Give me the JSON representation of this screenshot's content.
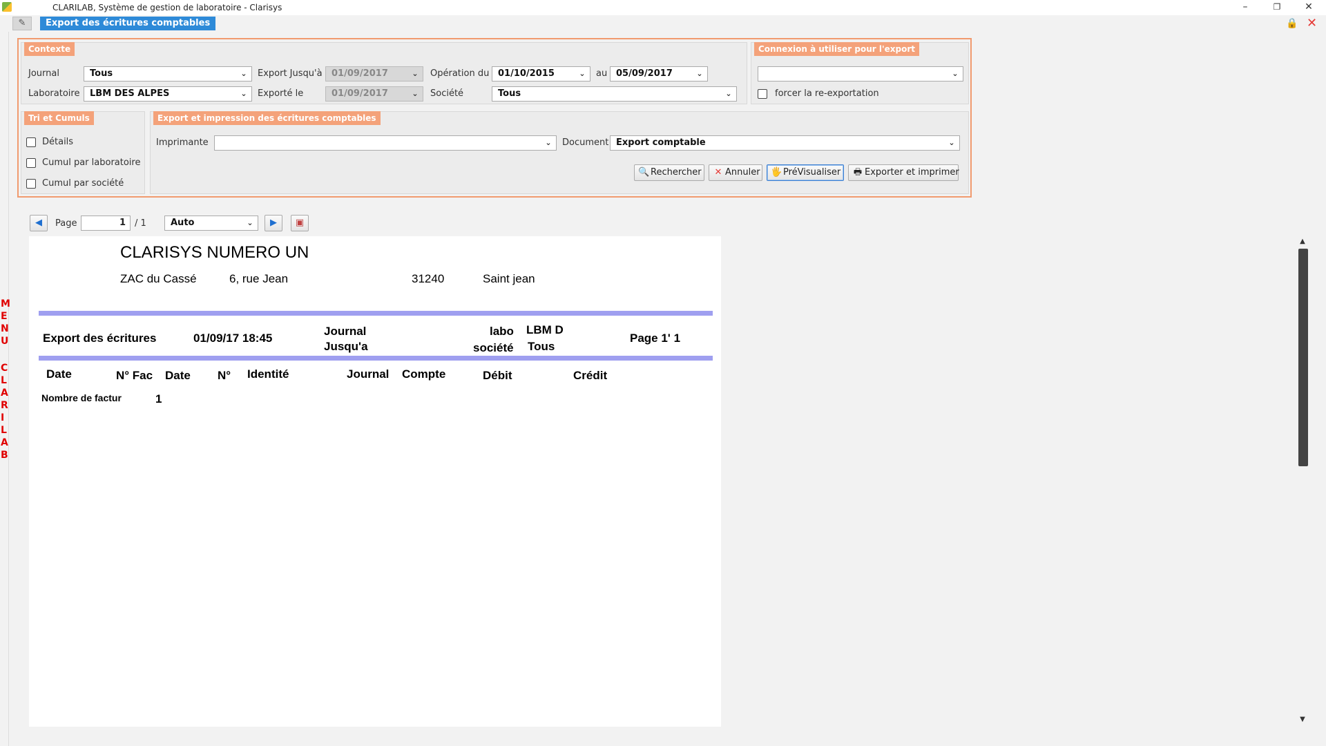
{
  "window": {
    "title": "CLARILAB, Système de gestion de laboratoire - Clarisys",
    "minimize": "–",
    "restore": "❐",
    "close": "✕"
  },
  "tabs": {
    "active": "Export des écritures comptables"
  },
  "side_menu": [
    "M",
    "E",
    "N",
    "U",
    "C",
    "L",
    "A",
    "R",
    "I",
    "L",
    "A",
    "B"
  ],
  "contexte": {
    "title": "Contexte",
    "journal_label": "Journal",
    "journal_value": "Tous",
    "laboratoire_label": "Laboratoire",
    "laboratoire_value": "LBM DES ALPES",
    "export_jusqua_label": "Export Jusqu'à",
    "export_jusqua_value": "01/09/2017",
    "exporte_le_label": "Exporté le",
    "exporte_le_value": "01/09/2017",
    "operation_du_label": "Opération du",
    "operation_du_value": "01/10/2015",
    "au_label": "au",
    "au_value": "05/09/2017",
    "societe_label": "Société",
    "societe_value": "Tous"
  },
  "connexion": {
    "title": "Connexion à utiliser pour l'export",
    "value": "",
    "forcer_label": "forcer la re-exportation"
  },
  "tri": {
    "title": "Tri et Cumuls",
    "details": "Détails",
    "cumul_labo": "Cumul par laboratoire",
    "cumul_societe": "Cumul par société"
  },
  "export_print": {
    "title": "Export et impression des écritures comptables",
    "imprimante_label": "Imprimante",
    "imprimante_value": "",
    "document_label": "Document",
    "document_value": "Export comptable"
  },
  "buttons": {
    "rechercher": "Rechercher",
    "annuler": "Annuler",
    "previsualiser": "PréVisualiser",
    "exporter": "Exporter et imprimer"
  },
  "pager": {
    "page_label": "Page",
    "page_value": "1",
    "page_total": "/ 1",
    "zoom_value": "Auto"
  },
  "report": {
    "company": "CLARISYS NUMERO UN",
    "address1": "ZAC du Cassé",
    "address2": "6, rue Jean",
    "postcode": "31240",
    "city": "Saint jean",
    "export_title": "Export des écritures",
    "datetime": "01/09/17 18:45",
    "journal_label": "Journal",
    "jusqua_label": "Jusqu'a",
    "labo_label": "labo",
    "labo_value": "LBM D",
    "societe_label": "société",
    "societe_value": "Tous",
    "page_info": "Page 1' 1",
    "columns": [
      "Date",
      "N° Fac",
      "Date",
      "N°",
      "Identité",
      "Journal",
      "Compte",
      "Débit",
      "Crédit"
    ],
    "nombre_label": "Nombre de factur",
    "nombre_value": "1"
  }
}
